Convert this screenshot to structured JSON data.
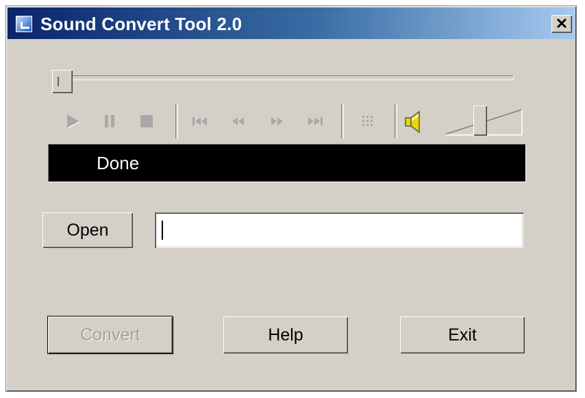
{
  "window": {
    "title": "Sound Convert Tool 2.0",
    "close_label": "✕"
  },
  "player": {
    "seek_position": 0.0,
    "volume_level": 0.45,
    "transport": [
      "play-icon",
      "pause-icon",
      "stop-icon",
      "skip-back-icon",
      "rewind-icon",
      "fast-forward-icon",
      "skip-forward-icon",
      "grid-icon",
      "speaker-icon"
    ]
  },
  "display": {
    "status": "Done"
  },
  "file": {
    "open_label": "Open",
    "path_value": ""
  },
  "actions": {
    "convert_label": "Convert",
    "help_label": "Help",
    "exit_label": "Exit"
  },
  "colors": {
    "title_start": "#0a246a",
    "title_end": "#a6caf0",
    "face": "#d4d0c8",
    "display_bg": "#000000",
    "display_text": "#ffffff",
    "speaker": "#e8d800"
  }
}
